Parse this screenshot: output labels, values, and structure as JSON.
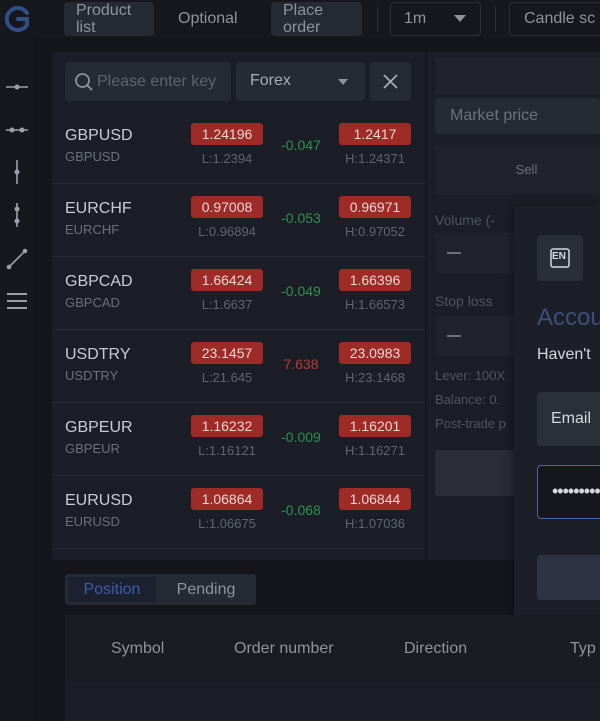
{
  "topbar": {
    "logo_icon": "logo-icon",
    "product_list_line1": "Product",
    "product_list_line2": "list",
    "optional": "Optional",
    "place_order_line1": "Place",
    "place_order_line2": "order",
    "interval": "1m",
    "chart_type": "Candle sc"
  },
  "left_tools": [
    "horizontal-line-icon",
    "horizontal-ray-icon",
    "vertical-line-icon",
    "vertical-segment-icon",
    "trend-line-icon",
    "menu-icon"
  ],
  "market": {
    "search_placeholder": "Please enter key",
    "category": "Forex",
    "rows": [
      {
        "symbol": "GBPUSD",
        "sub": "GBPUSD",
        "bid": "1.24196",
        "ask": "1.2417",
        "low": "L:1.2394",
        "high": "H:1.24371",
        "change": "-0.047",
        "change_color": "green"
      },
      {
        "symbol": "EURCHF",
        "sub": "EURCHF",
        "bid": "0.97008",
        "ask": "0.96971",
        "low": "L:0.96894",
        "high": "H:0.97052",
        "change": "-0.053",
        "change_color": "green"
      },
      {
        "symbol": "GBPCAD",
        "sub": "GBPCAD",
        "bid": "1.66424",
        "ask": "1.66396",
        "low": "L:1.6637",
        "high": "H:1.66573",
        "change": "-0.049",
        "change_color": "green"
      },
      {
        "symbol": "USDTRY",
        "sub": "USDTRY",
        "bid": "23.1457",
        "ask": "23.0983",
        "low": "L:21.645",
        "high": "H:23.1468",
        "change": "7.638",
        "change_color": "red"
      },
      {
        "symbol": "GBPEUR",
        "sub": "GBPEUR",
        "bid": "1.16232",
        "ask": "1.16201",
        "low": "L:1.16121",
        "high": "H:1.16271",
        "change": "-0.009",
        "change_color": "green"
      },
      {
        "symbol": "EURUSD",
        "sub": "EURUSD",
        "bid": "1.06864",
        "ask": "1.06844",
        "low": "L:1.06675",
        "high": "H:1.07036",
        "change": "-0.068",
        "change_color": "green"
      }
    ]
  },
  "order_panel": {
    "market_price": "Market price",
    "sell": "Sell",
    "volume_label": "Volume (-",
    "stop_loss_label": "Stop loss",
    "lever_label": "Lever: 100X",
    "balance_label": "Balance: 0.",
    "post_trade_label": "Post-trade p"
  },
  "account": {
    "lang_badge": "EN",
    "title": "Accou",
    "subtitle": "Haven't",
    "email": "Email",
    "password": "••••••••••"
  },
  "positions": {
    "tab_position": "Position",
    "tab_pending": "Pending",
    "columns": [
      "Symbol",
      "Order number",
      "Direction",
      "Typ"
    ]
  },
  "colors": {
    "accent": "#3a5ca8",
    "price_box": "#9e2b25",
    "change_green": "#2e8f4f",
    "change_red": "#b53a33"
  }
}
